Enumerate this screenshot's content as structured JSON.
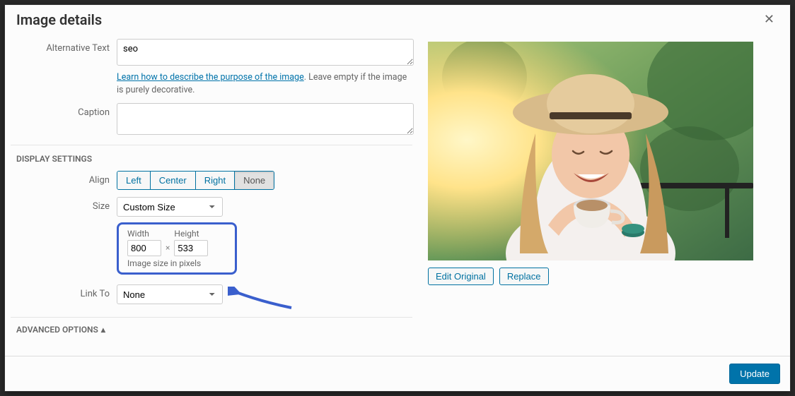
{
  "header": {
    "title": "Image details"
  },
  "fields": {
    "alt_label": "Alternative Text",
    "alt_value": "seo",
    "alt_help_link": "Learn how to describe the purpose of the image",
    "alt_help_rest": ". Leave empty if the image is purely decorative.",
    "caption_label": "Caption",
    "caption_value": ""
  },
  "display": {
    "section_title": "Display Settings",
    "align_label": "Align",
    "align_options": {
      "left": "Left",
      "center": "Center",
      "right": "Right",
      "none": "None"
    },
    "align_selected": "None",
    "size_label": "Size",
    "size_value": "Custom Size",
    "width_label": "Width",
    "width_value": "800",
    "height_label": "Height",
    "height_value": "533",
    "size_hint": "Image size in pixels",
    "linkto_label": "Link To",
    "linkto_value": "None"
  },
  "advanced": {
    "label": "Advanced Options"
  },
  "preview": {
    "edit_label": "Edit Original",
    "replace_label": "Replace"
  },
  "footer": {
    "update": "Update"
  }
}
